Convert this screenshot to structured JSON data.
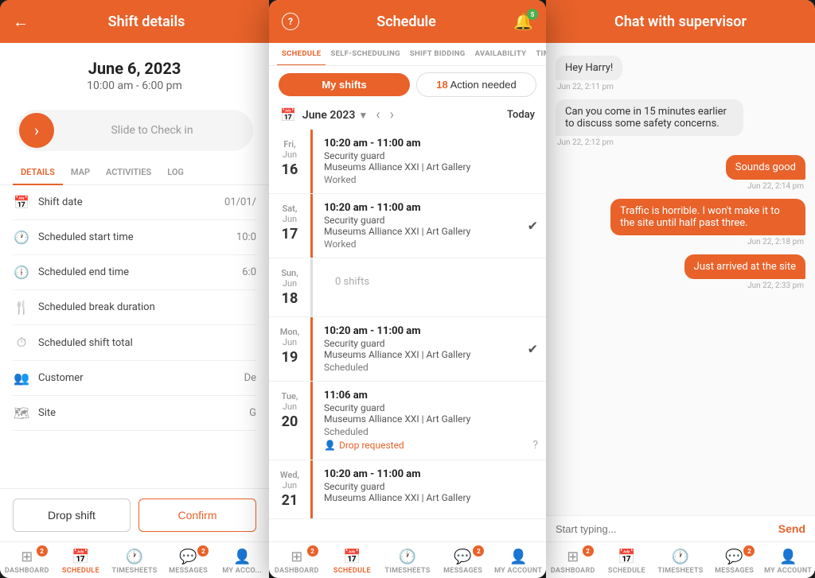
{
  "left": {
    "header_title": "Shift details",
    "back_icon": "←",
    "date": "June 6, 2023",
    "time_range": "10:00 am - 6:00 pm",
    "slide_text": "Slide to Check in",
    "tabs": [
      "DETAILS",
      "MAP",
      "ACTIVITIES",
      "LOG"
    ],
    "active_tab": "DETAILS",
    "rows": [
      {
        "icon": "📅",
        "label": "Shift date",
        "value": "01/01/"
      },
      {
        "icon": "🕐",
        "label": "Scheduled start time",
        "value": "10:0"
      },
      {
        "icon": "🕕",
        "label": "Scheduled end time",
        "value": "6:0"
      },
      {
        "icon": "🍴",
        "label": "Scheduled break duration",
        "value": ""
      },
      {
        "icon": "⏱",
        "label": "Scheduled shift total",
        "value": ""
      },
      {
        "icon": "👥",
        "label": "Customer",
        "value": "De"
      },
      {
        "icon": "🗺",
        "label": "Site",
        "value": "G"
      }
    ],
    "btn_drop": "Drop shift",
    "btn_confirm": "Confirm",
    "nav": [
      {
        "icon": "⊞",
        "label": "DASHBOARD",
        "badge": "2",
        "active": false
      },
      {
        "icon": "📅",
        "label": "SCHEDULE",
        "badge": "",
        "active": true
      },
      {
        "icon": "🕐",
        "label": "TIMESHEETS",
        "badge": "",
        "active": false
      },
      {
        "icon": "💬",
        "label": "MESSAGES",
        "badge": "2",
        "active": false
      },
      {
        "icon": "👤",
        "label": "MY ACCO...",
        "badge": "",
        "active": false
      }
    ]
  },
  "middle": {
    "help_icon": "?",
    "title": "Schedule",
    "notif_badge": "5",
    "tabs": [
      "SCHEDULE",
      "SELF-SCHEDULING",
      "SHIFT BIDDING",
      "AVAILABILITY",
      "TIME OFF"
    ],
    "active_tab": "SCHEDULE",
    "filter_my_shifts": "My shifts",
    "filter_action": "18 Action needed",
    "month_label": "June 2023",
    "today_label": "Today",
    "days": [
      {
        "day_name": "Fri,",
        "day_month": "Jun",
        "day_num": "16",
        "time_range": "10:20 am - 11:00 am",
        "role": "Security guard",
        "location": "Museums Alliance XXI | Art Gallery",
        "status": "Worked",
        "has_check": false,
        "drop_requested": false,
        "zero_shifts": false
      },
      {
        "day_name": "Sat,",
        "day_month": "Jun",
        "day_num": "17",
        "time_range": "10:20 am - 11:00 am",
        "role": "Security guard",
        "location": "Museums Alliance XXI | Art Gallery",
        "status": "Worked",
        "has_check": true,
        "drop_requested": false,
        "zero_shifts": false
      },
      {
        "day_name": "Sun,",
        "day_month": "Jun",
        "day_num": "18",
        "time_range": "",
        "role": "",
        "location": "",
        "status": "0 shifts",
        "has_check": false,
        "drop_requested": false,
        "zero_shifts": true
      },
      {
        "day_name": "Mon,",
        "day_month": "Jun",
        "day_num": "19",
        "time_range": "10:20 am - 11:00 am",
        "role": "Security guard",
        "location": "Museums Alliance XXI | Art Gallery",
        "status": "Scheduled",
        "has_check": true,
        "drop_requested": false,
        "zero_shifts": false
      },
      {
        "day_name": "Tue,",
        "day_month": "Jun",
        "day_num": "20",
        "time_range": "11:06 am",
        "role": "Security guard",
        "location": "Museums Alliance XXI | Art Gallery",
        "status": "Scheduled",
        "has_check": false,
        "drop_requested": true,
        "zero_shifts": false
      },
      {
        "day_name": "Wed,",
        "day_month": "Jun",
        "day_num": "21",
        "time_range": "10:20 am - 11:00 am",
        "role": "Security guard",
        "location": "Museums Alliance XXI | Art Gallery",
        "status": "",
        "has_check": false,
        "drop_requested": false,
        "zero_shifts": false
      }
    ],
    "drop_requested_text": "Drop requested",
    "nav": [
      {
        "icon": "⊞",
        "label": "DASHBOARD",
        "badge": "2",
        "active": false
      },
      {
        "icon": "📅",
        "label": "SCHEDULE",
        "badge": "",
        "active": true
      },
      {
        "icon": "🕐",
        "label": "TIMESHEETS",
        "badge": "",
        "active": false
      },
      {
        "icon": "💬",
        "label": "MESSAGES",
        "badge": "2",
        "active": false
      },
      {
        "icon": "👤",
        "label": "MY ACCOUNT",
        "badge": "",
        "active": false
      }
    ]
  },
  "right": {
    "title": "Chat with supervisor",
    "messages": [
      {
        "type": "received",
        "text": "Hey Harry!",
        "time": "Jun 22, 2:11 pm"
      },
      {
        "type": "received",
        "text": "Can you come in 15 minutes earlier to discuss some safety concerns.",
        "time": "Jun 22, 2:12 pm"
      },
      {
        "type": "sent",
        "text": "Sounds good",
        "time": "✓ Jun 22, 2:14 pm"
      },
      {
        "type": "sent",
        "text": "Traffic is horrible. I won't make it to the site until half past three.",
        "time": "✓ Jun 22, 2:18 pm"
      },
      {
        "type": "sent",
        "text": "Just arrived at the site",
        "time": "✓ Jun 22, 2:33 pm"
      }
    ],
    "input_placeholder": "Start typing...",
    "send_label": "Send",
    "nav": [
      {
        "icon": "⊞",
        "label": "DASHBOARD",
        "badge": "2",
        "active": false
      },
      {
        "icon": "📅",
        "label": "SCHEDULE",
        "badge": "",
        "active": false
      },
      {
        "icon": "🕐",
        "label": "TIMESHEETS",
        "badge": "",
        "active": false
      },
      {
        "icon": "💬",
        "label": "MESSAGES",
        "badge": "2",
        "active": false
      },
      {
        "icon": "👤",
        "label": "MY ACCOUNT",
        "badge": "",
        "active": false
      }
    ]
  }
}
